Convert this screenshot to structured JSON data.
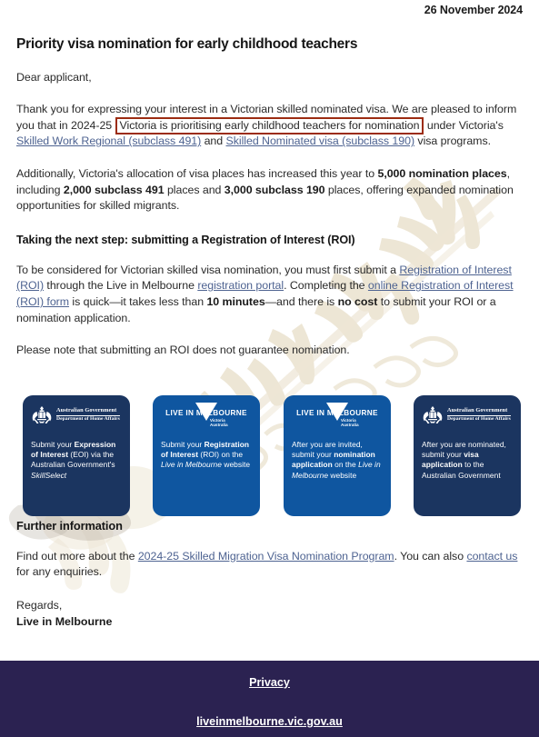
{
  "document": {
    "date": "26 November 2024",
    "title": "Priority visa nomination for early childhood teachers",
    "salutation": "Dear applicant,"
  },
  "paragraphs": {
    "p1": {
      "part1": "Thank you for expressing your interest in a Victorian skilled nominated visa. We are pleased to inform you that in 2024-25 ",
      "highlight": "Victoria is prioritising early childhood teachers for nomination",
      "part2": " under Victoria's ",
      "link1": "Skilled Work Regional (subclass 491)",
      "part3": " and ",
      "link2": "Skilled Nominated visa (subclass 190)",
      "part4": " visa programs."
    },
    "p2": {
      "part1": "Additionally, Victoria's allocation of visa places has increased this year to ",
      "b1": "5,000 nomination places",
      "part2": ", including ",
      "b2": "2,000 subclass 491",
      "part3": " places and ",
      "b3": "3,000 subclass 190",
      "part4": " places, offering expanded nomination opportunities for skilled migrants."
    },
    "subheading": "Taking the next step: submitting a Registration of Interest (ROI)",
    "p3": {
      "part1": "To be considered for Victorian skilled visa nomination, you must first submit a ",
      "link1": "Registration of Interest (ROI)",
      "part2": " through the Live in Melbourne ",
      "link2": "registration portal",
      "part3": ". Completing the ",
      "link3": "online Registration of Interest (ROI) form",
      "part4": " is quick—it takes less than ",
      "b1": "10 minutes",
      "part5": "—and there is ",
      "b2": "no cost",
      "part6": " to submit your ROI or a nomination application."
    },
    "p4": "Please note that submitting an ROI does not guarantee nomination."
  },
  "flow": {
    "cards": [
      {
        "logo_kind": "australian-government-crest",
        "logo_line1": "Australian Government",
        "logo_line2": "Department of Home Affairs",
        "text_part1": "Submit your ",
        "text_bold": "Expression of Interest",
        "text_part2": " (EOI) via the Australian Government's ",
        "text_italic": "SkillSelect",
        "text_part3": "",
        "theme": "navy"
      },
      {
        "logo_kind": "live-in-melbourne",
        "logo_word": "LIVE IN MELBOURNE",
        "logo_sub1": "Victoria",
        "logo_sub2": "Australia",
        "text_part1": "Submit your ",
        "text_bold": "Registration of Interest",
        "text_part2": " (ROI) on the ",
        "text_italic": "Live in Melbourne",
        "text_part3": " website",
        "theme": "blue"
      },
      {
        "logo_kind": "live-in-melbourne",
        "logo_word": "LIVE IN MELBOURNE",
        "logo_sub1": "Victoria",
        "logo_sub2": "Australia",
        "text_part1": "After you are invited, submit your ",
        "text_bold": "nomination application",
        "text_part2": " on the ",
        "text_italic": "Live in Melbourne",
        "text_part3": " website",
        "theme": "blue"
      },
      {
        "logo_kind": "australian-government-crest",
        "logo_line1": "Australian Government",
        "logo_line2": "Department of Home Affairs",
        "text_part1": "After you are nominated, submit your ",
        "text_bold": "visa application",
        "text_part2": " to the Australian Government",
        "text_italic": "",
        "text_part3": "",
        "theme": "navy"
      }
    ],
    "separator": "❯"
  },
  "further": {
    "heading": "Further information",
    "part1": "Find out more about the ",
    "link1": "2024-25 Skilled Migration Visa Nomination Program",
    "part2": ". You can also ",
    "link2": "contact us",
    "part3": " for any enquiries."
  },
  "signoff": {
    "line1": "Regards,",
    "line2": "Live in Melbourne"
  },
  "footer": {
    "privacy": "Privacy",
    "website": "liveinmelbourne.vic.gov.au"
  },
  "colors": {
    "card_navy": "#1b3560",
    "card_blue": "#0f56a0",
    "highlight_border": "#9c2c12",
    "link": "#4e6391",
    "footer_bg": "#2b2251",
    "watermark": "#d8c9a8"
  }
}
